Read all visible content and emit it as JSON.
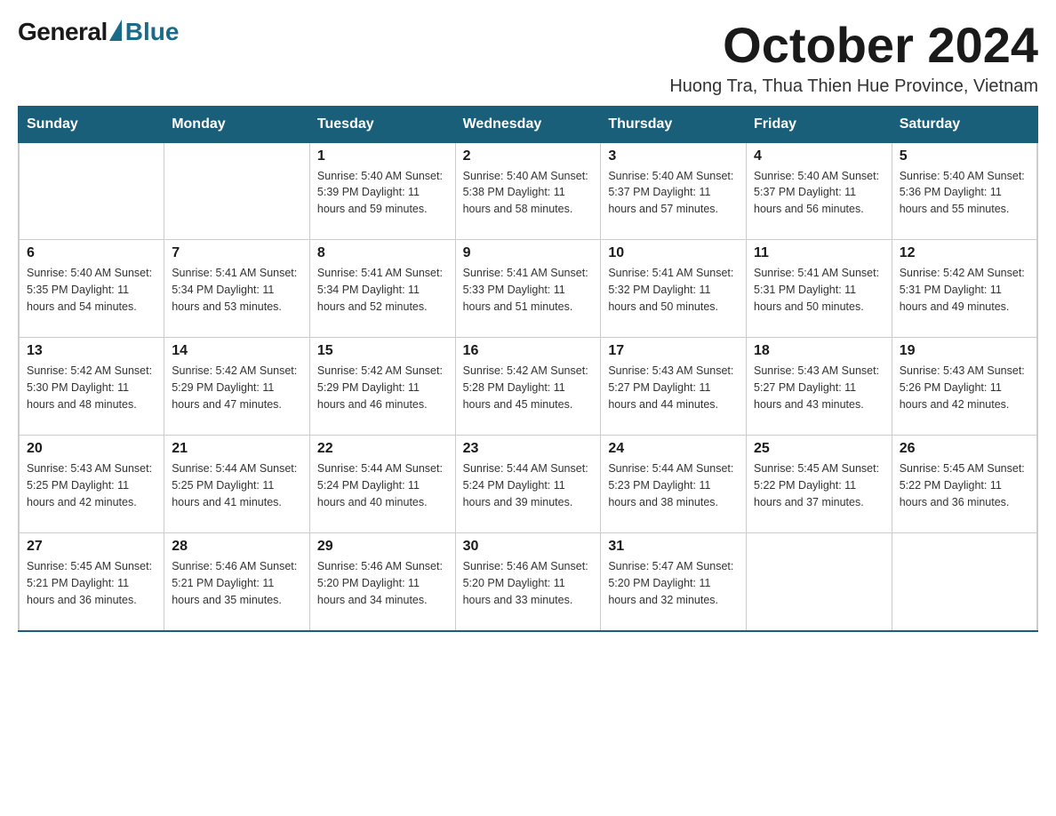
{
  "logo": {
    "general": "General",
    "blue": "Blue",
    "triangle_color": "#1a6b8a"
  },
  "header": {
    "month_title": "October 2024",
    "subtitle": "Huong Tra, Thua Thien Hue Province, Vietnam"
  },
  "calendar": {
    "days_of_week": [
      "Sunday",
      "Monday",
      "Tuesday",
      "Wednesday",
      "Thursday",
      "Friday",
      "Saturday"
    ],
    "weeks": [
      [
        {
          "day": "",
          "info": ""
        },
        {
          "day": "",
          "info": ""
        },
        {
          "day": "1",
          "info": "Sunrise: 5:40 AM\nSunset: 5:39 PM\nDaylight: 11 hours\nand 59 minutes."
        },
        {
          "day": "2",
          "info": "Sunrise: 5:40 AM\nSunset: 5:38 PM\nDaylight: 11 hours\nand 58 minutes."
        },
        {
          "day": "3",
          "info": "Sunrise: 5:40 AM\nSunset: 5:37 PM\nDaylight: 11 hours\nand 57 minutes."
        },
        {
          "day": "4",
          "info": "Sunrise: 5:40 AM\nSunset: 5:37 PM\nDaylight: 11 hours\nand 56 minutes."
        },
        {
          "day": "5",
          "info": "Sunrise: 5:40 AM\nSunset: 5:36 PM\nDaylight: 11 hours\nand 55 minutes."
        }
      ],
      [
        {
          "day": "6",
          "info": "Sunrise: 5:40 AM\nSunset: 5:35 PM\nDaylight: 11 hours\nand 54 minutes."
        },
        {
          "day": "7",
          "info": "Sunrise: 5:41 AM\nSunset: 5:34 PM\nDaylight: 11 hours\nand 53 minutes."
        },
        {
          "day": "8",
          "info": "Sunrise: 5:41 AM\nSunset: 5:34 PM\nDaylight: 11 hours\nand 52 minutes."
        },
        {
          "day": "9",
          "info": "Sunrise: 5:41 AM\nSunset: 5:33 PM\nDaylight: 11 hours\nand 51 minutes."
        },
        {
          "day": "10",
          "info": "Sunrise: 5:41 AM\nSunset: 5:32 PM\nDaylight: 11 hours\nand 50 minutes."
        },
        {
          "day": "11",
          "info": "Sunrise: 5:41 AM\nSunset: 5:31 PM\nDaylight: 11 hours\nand 50 minutes."
        },
        {
          "day": "12",
          "info": "Sunrise: 5:42 AM\nSunset: 5:31 PM\nDaylight: 11 hours\nand 49 minutes."
        }
      ],
      [
        {
          "day": "13",
          "info": "Sunrise: 5:42 AM\nSunset: 5:30 PM\nDaylight: 11 hours\nand 48 minutes."
        },
        {
          "day": "14",
          "info": "Sunrise: 5:42 AM\nSunset: 5:29 PM\nDaylight: 11 hours\nand 47 minutes."
        },
        {
          "day": "15",
          "info": "Sunrise: 5:42 AM\nSunset: 5:29 PM\nDaylight: 11 hours\nand 46 minutes."
        },
        {
          "day": "16",
          "info": "Sunrise: 5:42 AM\nSunset: 5:28 PM\nDaylight: 11 hours\nand 45 minutes."
        },
        {
          "day": "17",
          "info": "Sunrise: 5:43 AM\nSunset: 5:27 PM\nDaylight: 11 hours\nand 44 minutes."
        },
        {
          "day": "18",
          "info": "Sunrise: 5:43 AM\nSunset: 5:27 PM\nDaylight: 11 hours\nand 43 minutes."
        },
        {
          "day": "19",
          "info": "Sunrise: 5:43 AM\nSunset: 5:26 PM\nDaylight: 11 hours\nand 42 minutes."
        }
      ],
      [
        {
          "day": "20",
          "info": "Sunrise: 5:43 AM\nSunset: 5:25 PM\nDaylight: 11 hours\nand 42 minutes."
        },
        {
          "day": "21",
          "info": "Sunrise: 5:44 AM\nSunset: 5:25 PM\nDaylight: 11 hours\nand 41 minutes."
        },
        {
          "day": "22",
          "info": "Sunrise: 5:44 AM\nSunset: 5:24 PM\nDaylight: 11 hours\nand 40 minutes."
        },
        {
          "day": "23",
          "info": "Sunrise: 5:44 AM\nSunset: 5:24 PM\nDaylight: 11 hours\nand 39 minutes."
        },
        {
          "day": "24",
          "info": "Sunrise: 5:44 AM\nSunset: 5:23 PM\nDaylight: 11 hours\nand 38 minutes."
        },
        {
          "day": "25",
          "info": "Sunrise: 5:45 AM\nSunset: 5:22 PM\nDaylight: 11 hours\nand 37 minutes."
        },
        {
          "day": "26",
          "info": "Sunrise: 5:45 AM\nSunset: 5:22 PM\nDaylight: 11 hours\nand 36 minutes."
        }
      ],
      [
        {
          "day": "27",
          "info": "Sunrise: 5:45 AM\nSunset: 5:21 PM\nDaylight: 11 hours\nand 36 minutes."
        },
        {
          "day": "28",
          "info": "Sunrise: 5:46 AM\nSunset: 5:21 PM\nDaylight: 11 hours\nand 35 minutes."
        },
        {
          "day": "29",
          "info": "Sunrise: 5:46 AM\nSunset: 5:20 PM\nDaylight: 11 hours\nand 34 minutes."
        },
        {
          "day": "30",
          "info": "Sunrise: 5:46 AM\nSunset: 5:20 PM\nDaylight: 11 hours\nand 33 minutes."
        },
        {
          "day": "31",
          "info": "Sunrise: 5:47 AM\nSunset: 5:20 PM\nDaylight: 11 hours\nand 32 minutes."
        },
        {
          "day": "",
          "info": ""
        },
        {
          "day": "",
          "info": ""
        }
      ]
    ]
  }
}
